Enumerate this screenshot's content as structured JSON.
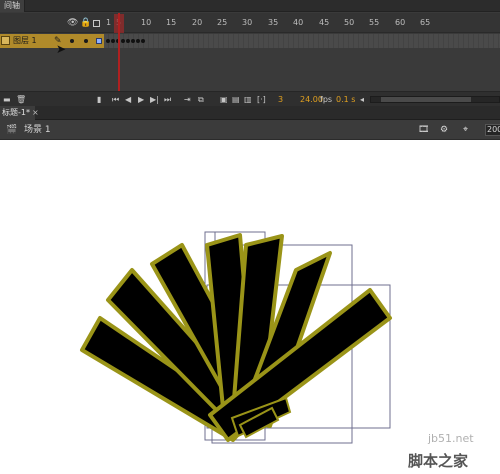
{
  "panel": {
    "tab_label": "间轴"
  },
  "ruler": {
    "ticks": [
      "1",
      "5",
      "10",
      "15",
      "20",
      "25",
      "30",
      "35",
      "40",
      "45",
      "50",
      "55",
      "60",
      "65"
    ]
  },
  "layer": {
    "name": "图层 1"
  },
  "footer": {
    "frame": "3",
    "fps": "24.00",
    "fps_unit": "fps",
    "time": "0.1 s"
  },
  "document": {
    "tab": "标题-1*",
    "close": "×",
    "scene": "场景 1",
    "zoom": "200"
  },
  "watermark": {
    "site": "jb51.net",
    "brand": "脚本之家"
  },
  "colors": {
    "shape_fill": "#000000",
    "shape_stroke": "#9a9418",
    "bbox": "#6f6f8f",
    "layer_highlight": "#b08a2a",
    "playhead": "#b02020",
    "orange_value": "#e0a020"
  },
  "icons": [
    "eye-icon",
    "lock-icon",
    "outline-icon",
    "pencil-icon",
    "cursor-icon",
    "folder-icon",
    "delete-icon",
    "play-icon",
    "scene-icon"
  ]
}
